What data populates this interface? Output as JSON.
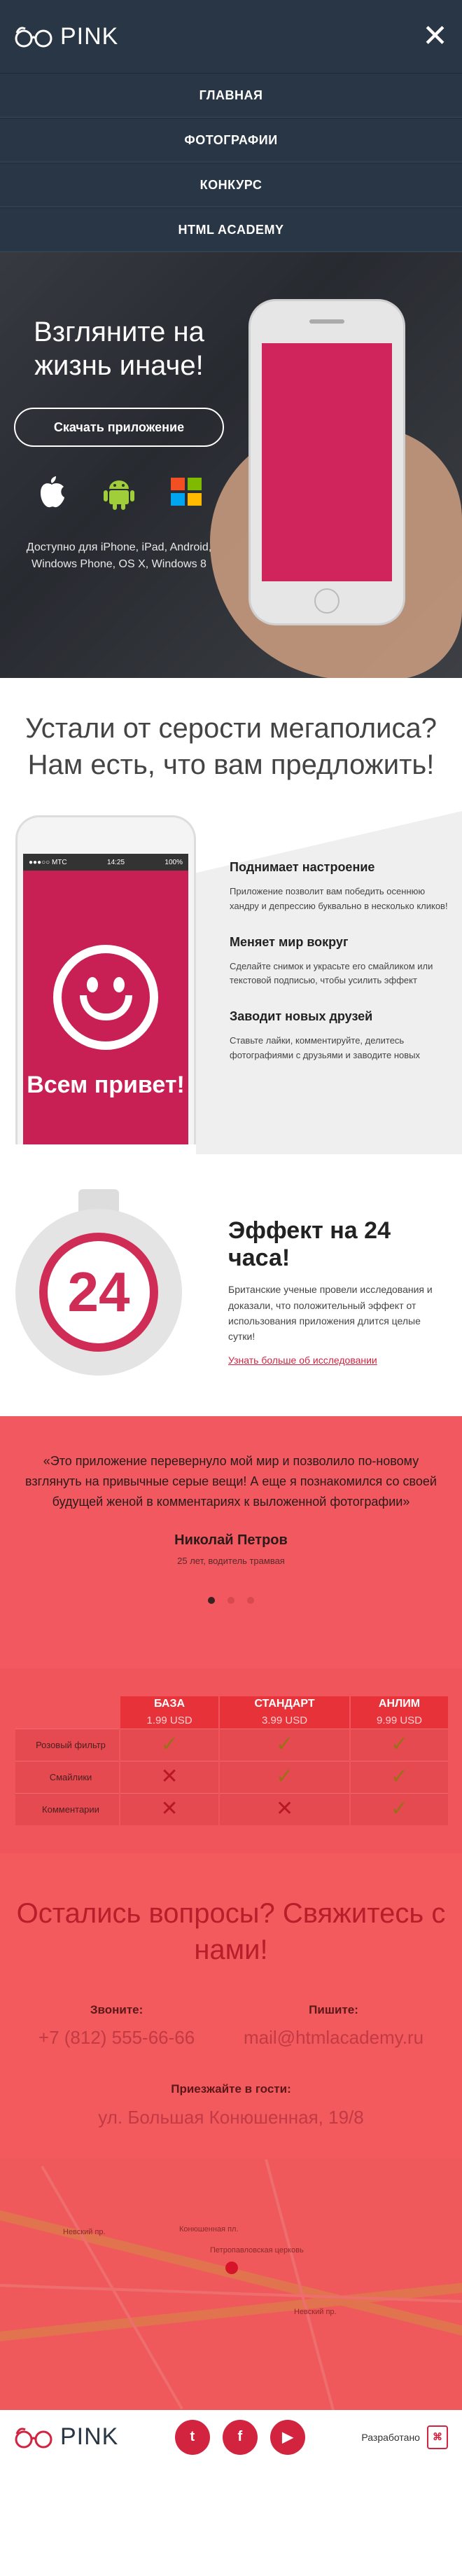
{
  "header": {
    "logo_text": "PINK",
    "close_glyph": "✕"
  },
  "nav": {
    "items": [
      "ГЛАВНАЯ",
      "ФОТОГРАФИИ",
      "КОНКУРС",
      "HTML ACADEMY"
    ]
  },
  "hero": {
    "title": "Взгляните на жизнь иначе!",
    "button_label": "Скачать приложение",
    "platforms": [
      "apple-icon",
      "android-icon",
      "windows-icon"
    ],
    "note": "Доступно для iPhone, iPad, Android, Windows Phone, OS X, Windows 8"
  },
  "tagline": "Устали от серости мегаполиса? Нам есть, что вам предложить!",
  "features": {
    "phone_status_left": "●●●○○ MTC",
    "phone_status_time": "14:25",
    "phone_status_right": "100%",
    "phone_caption": "Всем привет!",
    "items": [
      {
        "title": "Поднимает настроение",
        "text": "Приложение позволит вам победить осеннюю хандру и депрессию буквально в несколько кликов!"
      },
      {
        "title": "Меняет мир вокруг",
        "text": "Сделайте снимок и украсьте его смайликом или текстовой подписью, чтобы усилить эффект"
      },
      {
        "title": "Заводит новых друзей",
        "text": "Ставьте лайки, комментируйте, делитесь фотографиями с друзьями и заводите новых"
      }
    ]
  },
  "effect": {
    "timer_value": "24",
    "title": "Эффект на 24 часа!",
    "text": "Британские ученые провели исследования и доказали, что положительный эффект от использования приложения длится целые сутки!",
    "link": "Узнать больше об исследовании"
  },
  "review": {
    "quote": "«Это приложение перевернуло мой мир и позволило по-новому взглянуть на привычные серые вещи! А еще я познакомился со своей будущей женой в комментариях к выложенной фотографии»",
    "author": "Николай Петров",
    "role": "25 лет, водитель трамвая",
    "dots": 3,
    "active_dot": 0
  },
  "pricing": {
    "plans": [
      {
        "name": "БАЗА",
        "price": "1.99 USD"
      },
      {
        "name": "СТАНДАРТ",
        "price": "3.99 USD"
      },
      {
        "name": "АНЛИМ",
        "price": "9.99 USD"
      }
    ],
    "rows": [
      {
        "label": "Розовый фильтр",
        "values": [
          "yes",
          "yes",
          "yes"
        ]
      },
      {
        "label": "Смайлики",
        "values": [
          "no",
          "yes",
          "yes"
        ]
      },
      {
        "label": "Комментарии",
        "values": [
          "no",
          "no",
          "yes"
        ]
      }
    ],
    "yes_glyph": "✓",
    "no_glyph": "✕",
    "colors": {
      "yes": "#9c6e19",
      "no": "#b81821",
      "accent": "#e8323a"
    }
  },
  "contacts": {
    "title": "Остались вопросы? Свяжитесь с нами!",
    "phone_label": "Звоните:",
    "phone": "+7 (812) 555-66-66",
    "email_label": "Пишите:",
    "email": "mail@htmlacademy.ru",
    "address_label": "Приезжайте в гости:",
    "address": "ул. Большая Конюшенная, 19/8"
  },
  "map": {
    "labels": [
      "Невский пр.",
      "Невский пр.",
      "Конюшенная пл.",
      "Петропавловская церковь"
    ]
  },
  "footer": {
    "logo_text": "PINK",
    "socials": [
      "twitter-icon",
      "facebook-icon",
      "youtube-icon"
    ],
    "social_glyphs": [
      "t",
      "f",
      "▶"
    ],
    "developer_label": "Разработано",
    "developer_badge": "HTML"
  }
}
